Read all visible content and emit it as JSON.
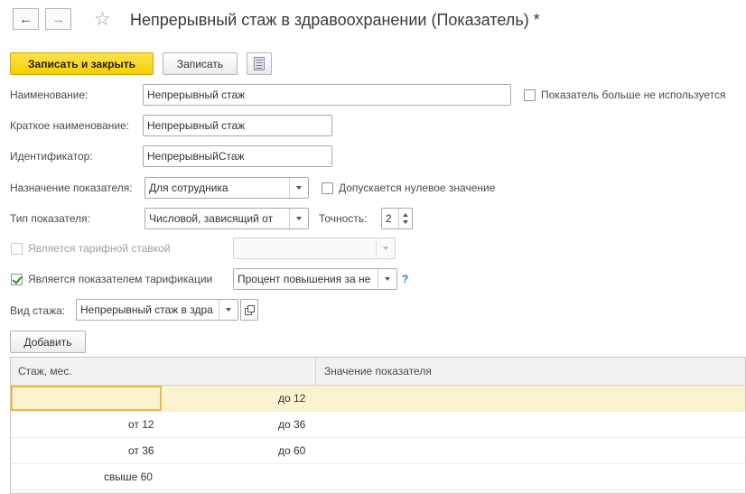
{
  "header": {
    "title": "Непрерывный стаж в здравоохранении (Показатель) *",
    "back_icon": "←",
    "forward_icon": "→",
    "star_icon": "☆"
  },
  "toolbar": {
    "save_close_label": "Записать и закрыть",
    "save_label": "Записать",
    "report_icon": "document-list"
  },
  "form": {
    "name_label": "Наименование:",
    "name_value": "Непрерывный стаж",
    "not_used_label": "Показатель больше не используется",
    "short_name_label": "Краткое наименование:",
    "short_name_value": "Непрерывный стаж",
    "identifier_label": "Идентификатор:",
    "identifier_value": "НепрерывныйСтаж",
    "purpose_label": "Назначение показателя:",
    "purpose_value": "Для сотрудника",
    "zero_allowed_label": "Допускается нулевое значение",
    "type_label": "Тип показателя:",
    "type_value": "Числовой, зависящий от",
    "precision_label": "Точность:",
    "precision_value": "2",
    "tariff_rate_label": "Является тарифной ставкой",
    "tariff_rate_value": "",
    "tariffication_label": "Является показателем тарификации",
    "tariffication_value": "Процент повышения за не",
    "help_mark": "?",
    "seniority_label": "Вид стажа:",
    "seniority_value": "Непрерывный стаж в здра"
  },
  "table": {
    "add_label": "Добавить",
    "columns": [
      "Стаж, мес.",
      "Значение показателя"
    ],
    "rows": [
      {
        "from": "",
        "to": "до 12",
        "value": ""
      },
      {
        "from": "от 12",
        "to": "до 36",
        "value": ""
      },
      {
        "from": "от 36",
        "to": "до 60",
        "value": ""
      },
      {
        "from": "свыше 60",
        "to": "",
        "value": ""
      }
    ]
  }
}
